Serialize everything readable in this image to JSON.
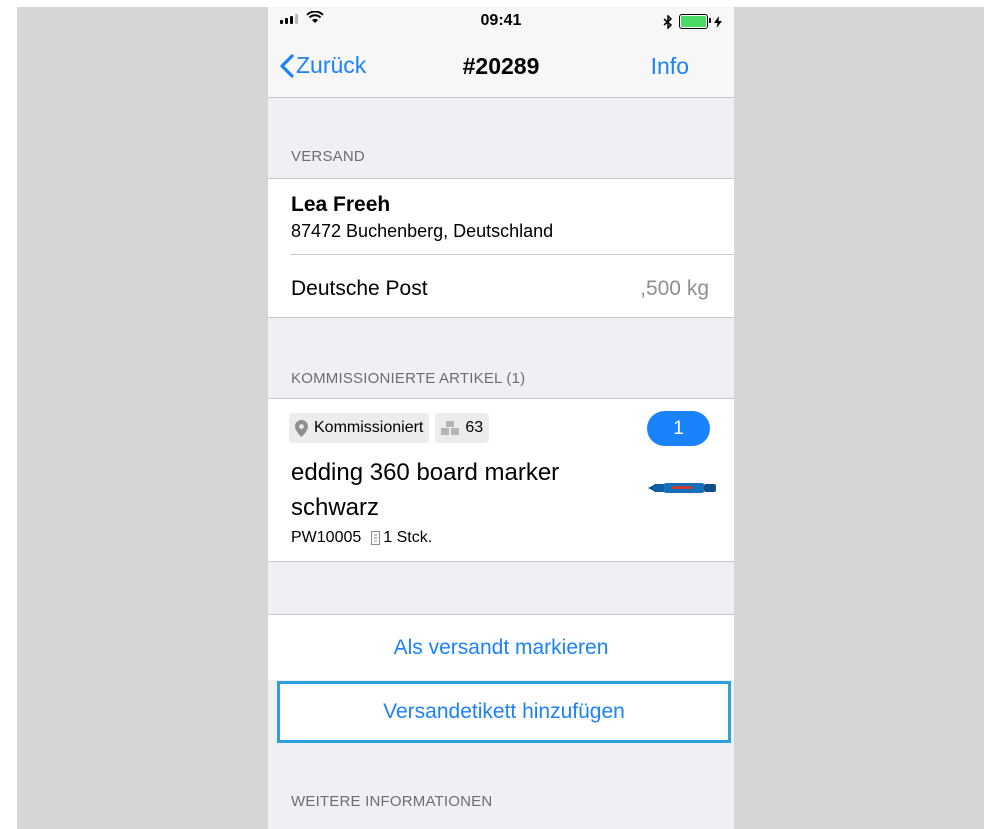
{
  "status_bar": {
    "time": "09:41",
    "signal_icon": "signal-icon",
    "wifi_icon": "wifi-icon",
    "bluetooth_icon": "bluetooth-icon",
    "battery_icon": "battery-icon",
    "charging_icon": "charging-bolt-icon",
    "battery_color": "#4cd964"
  },
  "nav": {
    "back_label": "Zurück",
    "title": "#20289",
    "right_label": "Info"
  },
  "shipping": {
    "header": "VERSAND",
    "name": "Lea Freeh",
    "address": "87472 Buchenberg, Deutschland",
    "carrier": "Deutsche Post",
    "weight": ",500 kg"
  },
  "picked": {
    "header": "KOMMISSIONIERTE ARTIKEL (1)",
    "items": [
      {
        "location_label": "Kommissioniert",
        "stock_count": "63",
        "badge": "1",
        "title": "edding 360 board marker schwarz",
        "sku": "PW10005",
        "quantity": "1 Stck.",
        "thumbnail": "blue board marker"
      }
    ]
  },
  "actions": {
    "mark_shipped": "Als versandt markieren",
    "add_label": "Versandetikett hinzufügen"
  },
  "more_info": {
    "header": "WEITERE INFORMATIONEN"
  },
  "colors": {
    "accent": "#1a82fb",
    "focus_ring": "#2ea0dc",
    "background": "#efeff4",
    "secondary_text": "#6d6d72"
  }
}
